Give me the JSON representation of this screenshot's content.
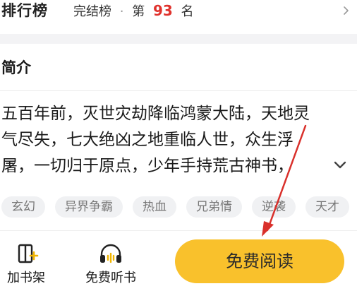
{
  "rank": {
    "title": "排行榜",
    "category": "完结榜",
    "separator": "·",
    "prefix": "第",
    "number": "93",
    "suffix": "名",
    "icon": "chevron-right-icon"
  },
  "intro": {
    "title": "简介",
    "lines": [
      "五百年前，灭世灾劫降临鸿蒙大陆，天地灵",
      "气尽失，七大绝凶之地重临人世，众生浮",
      "屠，一切归于原点，少年手持荒古神书，"
    ],
    "expand_icon": "chevron-down-icon"
  },
  "tags": [
    "玄幻",
    "异界争霸",
    "热血",
    "兄弟情",
    "逆袭",
    "天才"
  ],
  "bottom": {
    "shelf_label": "加书架",
    "shelf_icon": "add-to-shelf-icon",
    "listen_label": "免费听书",
    "listen_icon": "headphones-icon",
    "read_label": "免费阅读"
  },
  "colors": {
    "accent": "#f9c12c",
    "rank_number": "#e0322d",
    "annotation_arrow": "#d9302b"
  }
}
